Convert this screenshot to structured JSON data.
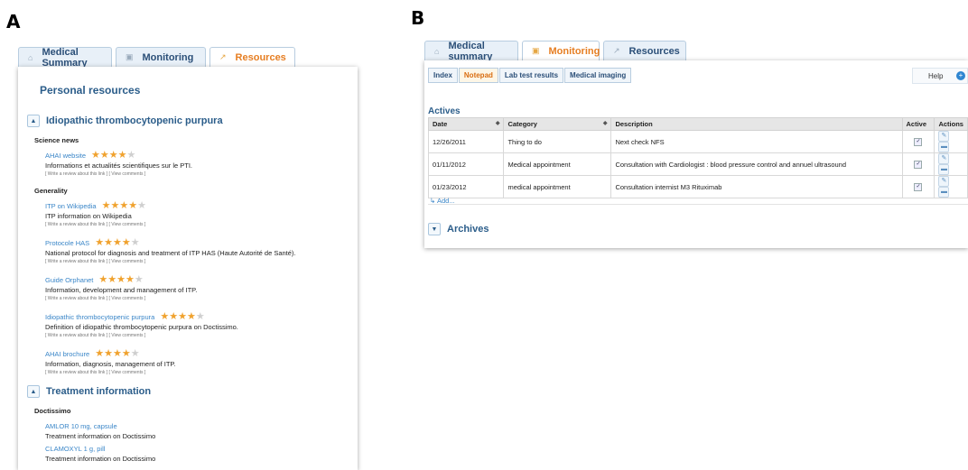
{
  "panel_a": {
    "letter": "A",
    "tabs": [
      {
        "label": "Medical Summary",
        "icon": "home-icon",
        "active": false
      },
      {
        "label": "Monitoring",
        "icon": "monitor-icon",
        "active": false
      },
      {
        "label": "Resources",
        "icon": "link-icon",
        "active": true
      }
    ],
    "title": "Personal resources",
    "sections": [
      {
        "title": "Idiopathic thrombocytopenic purpura",
        "groups": [
          {
            "name": "Science news",
            "items": [
              {
                "link": "AHAI website",
                "rating": 4,
                "description": "Informations et actualités scientifiques sur le PTI.",
                "write_review": "[ Write a review about this link ]",
                "view_comments": "[ View comments ]"
              }
            ]
          },
          {
            "name": "Generality",
            "items": [
              {
                "link": "ITP on Wikipedia",
                "rating": 4,
                "description": "ITP information on Wikipedia",
                "write_review": "[ Write a review about this link ]",
                "view_comments": "[ View comments ]"
              },
              {
                "link": "Protocole HAS",
                "rating": 4,
                "description": "National protocol for diagnosis and treatment of ITP HAS (Haute Autorité de Santé).",
                "write_review": "[ Write a review about this link ]",
                "view_comments": "[ View comments ]"
              },
              {
                "link": "Guide Orphanet",
                "rating": 4,
                "description": "Information, development and management of ITP.",
                "write_review": "[ Write a review about this link ]",
                "view_comments": "[ View comments ]"
              },
              {
                "link": "Idiopathic thrombocytopenic purpura",
                "rating": 4,
                "description": "Definition of idiopathic thrombocytopenic purpura on Doctissimo.",
                "write_review": "[ Write a review about this link ]",
                "view_comments": "[ View comments ]"
              },
              {
                "link": "AHAI brochure",
                "rating": 4,
                "description": "Information, diagnosis, management of ITP.",
                "write_review": "[ Write a review about this link ]",
                "view_comments": "[ View comments ]"
              }
            ]
          }
        ]
      },
      {
        "title": "Treatment information",
        "groups": [
          {
            "name": "Doctissimo",
            "items": [
              {
                "link": "AMLOR 10 mg, capsule",
                "description": "Treatment information on Doctissimo"
              },
              {
                "link": "CLAMOXYL 1 g, pill",
                "description": "Treatment information on Doctissimo"
              }
            ]
          }
        ]
      }
    ]
  },
  "panel_b": {
    "letter": "B",
    "tabs": [
      {
        "label": "Medical summary",
        "icon": "home-icon",
        "active": false
      },
      {
        "label": "Monitoring",
        "icon": "monitor-icon",
        "active": true
      },
      {
        "label": "Resources",
        "icon": "link-icon",
        "active": false
      }
    ],
    "subtabs": [
      {
        "label": "Index",
        "active": false
      },
      {
        "label": "Notepad",
        "active": true
      },
      {
        "label": "Lab test results",
        "active": false
      },
      {
        "label": "Medical imaging",
        "active": false
      }
    ],
    "help_label": "Help",
    "actives_title": "Actives",
    "columns": [
      "Date",
      "Category",
      "Description",
      "Active",
      "Actions"
    ],
    "rows": [
      {
        "date": "12/26/2011",
        "category": "Thing to do",
        "description": "Next check NFS",
        "active": true
      },
      {
        "date": "01/11/2012",
        "category": "Medical appointment",
        "description": "Consultation with Cardiologist : blood pressure control and annuel ultrasound",
        "active": true
      },
      {
        "date": "01/23/2012",
        "category": "medical appointment",
        "description": "Consultation internist M3 Rituximab",
        "active": true
      }
    ],
    "add_label": "Add...",
    "archives_title": "Archives"
  }
}
